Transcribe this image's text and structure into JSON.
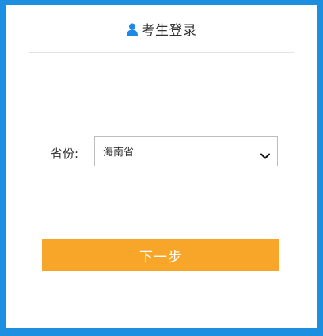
{
  "header": {
    "title": "考生登录",
    "icon": "user-icon"
  },
  "form": {
    "province_label": "省份:",
    "province_value": "海南省",
    "dropdown_icon": "chevron-down-icon"
  },
  "actions": {
    "next_label": "下一步"
  },
  "colors": {
    "background": "#1d8fe0",
    "accent_button": "#f7a62a",
    "icon_blue": "#1e88e5"
  }
}
